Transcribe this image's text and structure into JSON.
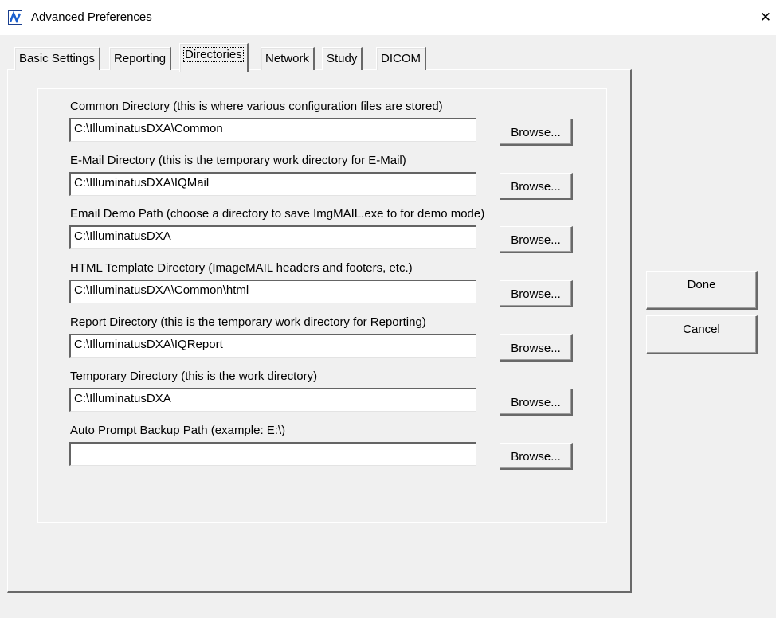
{
  "window": {
    "title": "Advanced Preferences",
    "app_icon": "app-logo-icon",
    "close_icon": "close-icon",
    "close_glyph": "✕"
  },
  "tabs": [
    {
      "label": "Basic Settings",
      "active": false
    },
    {
      "label": "Reporting",
      "active": false
    },
    {
      "label": "Directories",
      "active": true
    },
    {
      "label": "Network",
      "active": false
    },
    {
      "label": "Study",
      "active": false
    },
    {
      "label": "DICOM",
      "active": false
    }
  ],
  "directories": [
    {
      "label": "Common Directory (this is where various configuration files are stored)",
      "value": "C:\\IlluminatusDXA\\Common",
      "button": "Browse..."
    },
    {
      "label": "E-Mail Directory (this is the temporary work directory for E-Mail)",
      "value": "C:\\IlluminatusDXA\\IQMail",
      "button": "Browse..."
    },
    {
      "label": "Email Demo Path (choose a directory to save ImgMAIL.exe to for demo mode)",
      "value": "C:\\IlluminatusDXA",
      "button": "Browse..."
    },
    {
      "label": "HTML Template Directory (ImageMAIL headers and footers, etc.)",
      "value": "C:\\IlluminatusDXA\\Common\\html",
      "button": "Browse..."
    },
    {
      "label": "Report Directory (this is the temporary work directory for Reporting)",
      "value": "C:\\IlluminatusDXA\\IQReport",
      "button": "Browse..."
    },
    {
      "label": "Temporary Directory (this is the work directory)",
      "value": "C:\\IlluminatusDXA",
      "button": "Browse..."
    },
    {
      "label": "Auto Prompt Backup Path (example: E:\\)",
      "value": "",
      "button": "Browse..."
    }
  ],
  "actions": {
    "done_label": "Done",
    "cancel_label": "Cancel"
  },
  "colors": {
    "face": "#f0f0f0",
    "title_bg": "#ffffff",
    "icon_accent": "#1a3f8f",
    "shadow": "#696969"
  }
}
